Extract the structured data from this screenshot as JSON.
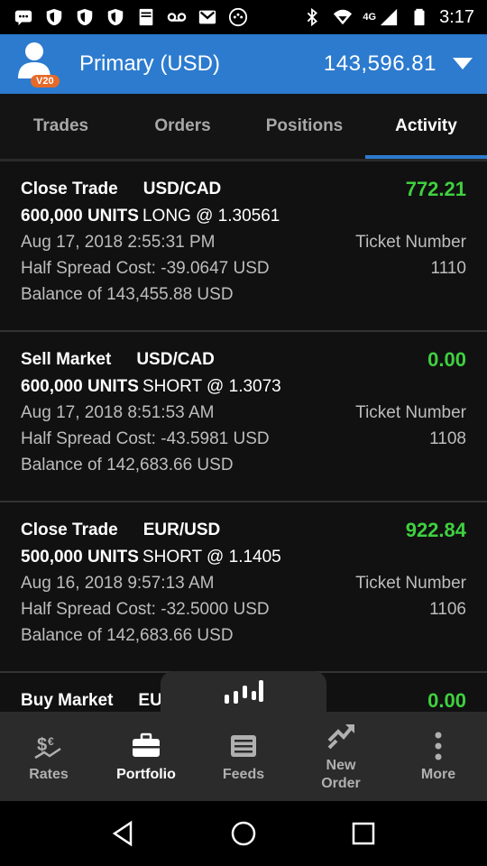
{
  "status_bar": {
    "time": "3:17",
    "network": "4G",
    "icons": [
      "message-icon",
      "shield-icon",
      "shield-icon",
      "shield-icon",
      "bible-icon",
      "voicemail-icon",
      "gmail-icon",
      "dots-icon",
      "bluetooth-icon",
      "wifi-icon",
      "signal-icon",
      "battery-icon"
    ]
  },
  "account": {
    "badge": "V20",
    "name": "Primary (USD)",
    "balance": "143,596.81"
  },
  "tabs": [
    {
      "label": "Trades",
      "active": false
    },
    {
      "label": "Orders",
      "active": false
    },
    {
      "label": "Positions",
      "active": false
    },
    {
      "label": "Activity",
      "active": true
    }
  ],
  "activity": [
    {
      "action": "Close Trade",
      "pair": "USD/CAD",
      "amount": "772.21",
      "units": "600,000 UNITS",
      "side": "LONG @ 1.30561",
      "datetime": "Aug 17, 2018 2:55:31 PM",
      "ticket_label": "Ticket Number",
      "spread": "Half Spread Cost: -39.0647 USD",
      "ticket": "1110",
      "balance": "Balance of 143,455.88 USD"
    },
    {
      "action": "Sell Market",
      "pair": "USD/CAD",
      "amount": "0.00",
      "units": "600,000 UNITS",
      "side": "SHORT @ 1.3073",
      "datetime": "Aug 17, 2018 8:51:53 AM",
      "ticket_label": "Ticket Number",
      "spread": "Half Spread Cost: -43.5981 USD",
      "ticket": "1108",
      "balance": "Balance of 142,683.66 USD"
    },
    {
      "action": "Close Trade",
      "pair": "EUR/USD",
      "amount": "922.84",
      "units": "500,000 UNITS",
      "side": "SHORT @ 1.1405",
      "datetime": "Aug 16, 2018 9:57:13 AM",
      "ticket_label": "Ticket Number",
      "spread": "Half Spread Cost: -32.5000 USD",
      "ticket": "1106",
      "balance": "Balance of 142,683.66 USD"
    },
    {
      "action": "Buy Market",
      "pair": "EU",
      "amount": "0.00",
      "units": "",
      "side": "",
      "datetime": "",
      "ticket_label": "",
      "spread": "",
      "ticket": "",
      "balance": ""
    }
  ],
  "bottom_nav": [
    {
      "label": "Rates",
      "icon": "rates-icon",
      "active": false
    },
    {
      "label": "Portfolio",
      "icon": "briefcase-icon",
      "active": true
    },
    {
      "label": "Feeds",
      "icon": "feeds-icon",
      "active": false
    },
    {
      "label": "New\nOrder",
      "icon": "new-order-icon",
      "active": false
    },
    {
      "label": "More",
      "icon": "more-icon",
      "active": false
    }
  ],
  "colors": {
    "accent": "#2c7bcf",
    "positive": "#3fd03f",
    "badge": "#e56a2a"
  }
}
